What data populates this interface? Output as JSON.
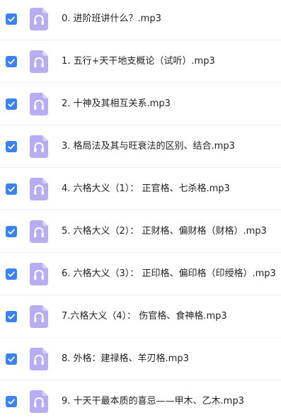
{
  "colors": {
    "checkbox": "#3b82f6",
    "file_icon": "#b8acf3",
    "file_icon_fold": "#d8d1f9",
    "headphones": "#ffffff"
  },
  "icons": {
    "checkbox": "checkbox-checked-icon",
    "file": "audio-file-headphones-icon"
  },
  "files": [
    {
      "name": "0. 进阶班讲什么？.mp3",
      "checked": true
    },
    {
      "name": "1. 五行+天干地支概论（试听）.mp3",
      "checked": true
    },
    {
      "name": "2. 十神及其相互关系.mp3",
      "checked": true
    },
    {
      "name": "3. 格局法及其与旺衰法的区别、结合.mp3",
      "checked": true
    },
    {
      "name": "4. 六格大义（1）： 正官格、七杀格.mp3",
      "checked": true
    },
    {
      "name": "5. 六格大义（2）： 正财格、偏财格（财格）.mp3",
      "checked": true
    },
    {
      "name": "6. 六格大义（3）： 正印格、偏印格（印绶格）.mp3",
      "checked": true
    },
    {
      "name": "7.六格大义（4）： 伤官格、食神格.mp3",
      "checked": true
    },
    {
      "name": "8. 外格：建禄格、羊刃格.mp3",
      "checked": true
    },
    {
      "name": "9. 十天干最本质的喜忌——甲木、乙木.mp3",
      "checked": true
    }
  ]
}
